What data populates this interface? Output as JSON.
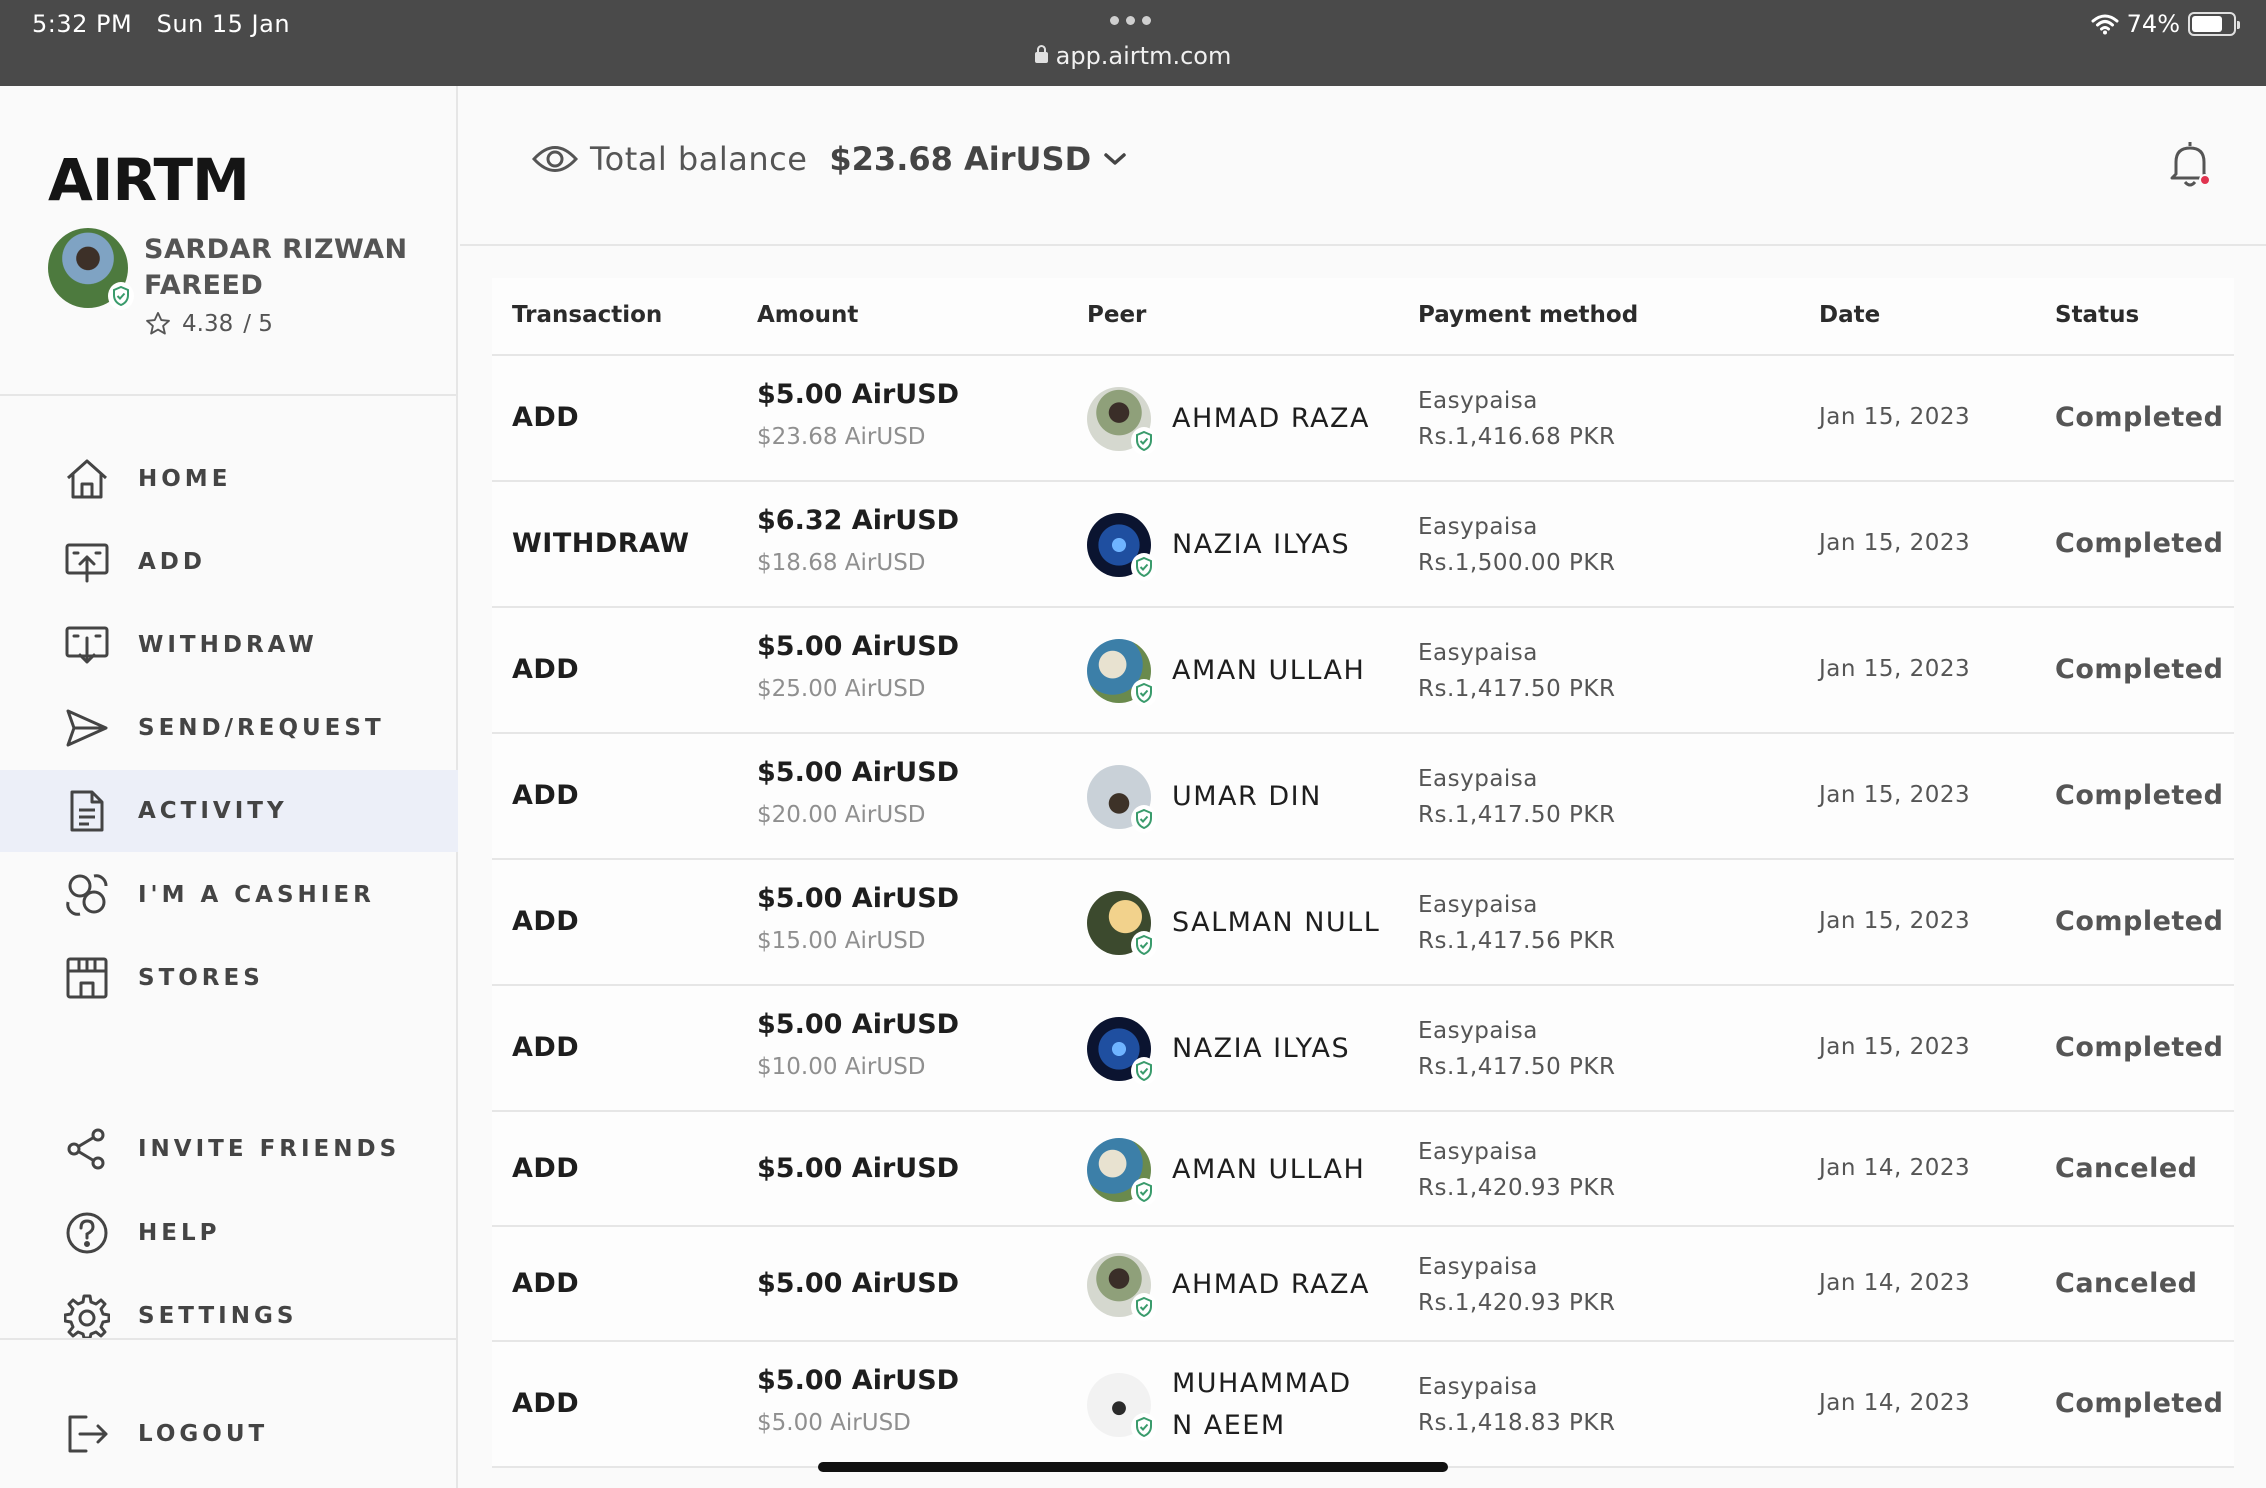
{
  "status_bar": {
    "time": "5:32 PM",
    "date": "Sun 15 Jan",
    "url": "app.airtm.com",
    "battery": "74%",
    "battery_level": 0.74
  },
  "sidebar": {
    "logo": "AIRTM",
    "user": {
      "name": "SARDAR RIZWAN FAREED",
      "rating": "4.38",
      "rating_max": "/ 5"
    },
    "nav": [
      {
        "label": "HOME",
        "icon": "home-icon"
      },
      {
        "label": "ADD",
        "icon": "add-funds-icon"
      },
      {
        "label": "WITHDRAW",
        "icon": "withdraw-icon"
      },
      {
        "label": "SEND/REQUEST",
        "icon": "send-icon"
      },
      {
        "label": "ACTIVITY",
        "icon": "document-icon",
        "active": true
      },
      {
        "label": "I'M A CASHIER",
        "icon": "cashier-icon"
      },
      {
        "label": "STORES",
        "icon": "store-icon"
      }
    ],
    "secondary_nav": [
      {
        "label": "INVITE FRIENDS",
        "icon": "share-icon"
      },
      {
        "label": "HELP",
        "icon": "help-icon"
      },
      {
        "label": "SETTINGS",
        "icon": "gear-icon"
      }
    ],
    "logout": {
      "label": "LOGOUT",
      "icon": "logout-icon"
    }
  },
  "header": {
    "balance_label": "Total balance",
    "balance_value": "$23.68 AirUSD"
  },
  "table": {
    "columns": [
      "Transaction",
      "Amount",
      "Peer",
      "Payment method",
      "Date",
      "Status"
    ],
    "rows": [
      {
        "type": "ADD",
        "amount": "$5.00 AirUSD",
        "balance": "$23.68 AirUSD",
        "peer": "AHMAD RAZA",
        "method": "Easypaisa",
        "method_amount": "Rs.1,416.68 PKR",
        "date": "Jan 15, 2023",
        "status": "Completed"
      },
      {
        "type": "WITHDRAW",
        "amount": "$6.32 AirUSD",
        "balance": "$18.68 AirUSD",
        "peer": "NAZIA ILYAS",
        "method": "Easypaisa",
        "method_amount": "Rs.1,500.00 PKR",
        "date": "Jan 15, 2023",
        "status": "Completed"
      },
      {
        "type": "ADD",
        "amount": "$5.00 AirUSD",
        "balance": "$25.00 AirUSD",
        "peer": "AMAN ULLAH",
        "method": "Easypaisa",
        "method_amount": "Rs.1,417.50 PKR",
        "date": "Jan 15, 2023",
        "status": "Completed"
      },
      {
        "type": "ADD",
        "amount": "$5.00 AirUSD",
        "balance": "$20.00 AirUSD",
        "peer": "UMAR DIN",
        "method": "Easypaisa",
        "method_amount": "Rs.1,417.50 PKR",
        "date": "Jan 15, 2023",
        "status": "Completed"
      },
      {
        "type": "ADD",
        "amount": "$5.00 AirUSD",
        "balance": "$15.00 AirUSD",
        "peer": "SALMAN NULL",
        "method": "Easypaisa",
        "method_amount": "Rs.1,417.56 PKR",
        "date": "Jan 15, 2023",
        "status": "Completed"
      },
      {
        "type": "ADD",
        "amount": "$5.00 AirUSD",
        "balance": "$10.00 AirUSD",
        "peer": "NAZIA ILYAS",
        "method": "Easypaisa",
        "method_amount": "Rs.1,417.50 PKR",
        "date": "Jan 15, 2023",
        "status": "Completed"
      },
      {
        "type": "ADD",
        "amount": "$5.00 AirUSD",
        "balance": "",
        "peer": "AMAN ULLAH",
        "method": "Easypaisa",
        "method_amount": "Rs.1,420.93 PKR",
        "date": "Jan 14, 2023",
        "status": "Canceled"
      },
      {
        "type": "ADD",
        "amount": "$5.00 AirUSD",
        "balance": "",
        "peer": "AHMAD RAZA",
        "method": "Easypaisa",
        "method_amount": "Rs.1,420.93 PKR",
        "date": "Jan 14, 2023",
        "status": "Canceled"
      },
      {
        "type": "ADD",
        "amount": "$5.00 AirUSD",
        "balance": "$5.00 AirUSD",
        "peer": "MUHAMMAD N AEEM",
        "method": "Easypaisa",
        "method_amount": "Rs.1,418.83 PKR",
        "date": "Jan 14, 2023",
        "status": "Completed"
      }
    ]
  },
  "colors": {
    "active_nav_bg": "#eceff8",
    "verified_green": "#3a9b6c",
    "notification_dot": "#e0334f"
  }
}
